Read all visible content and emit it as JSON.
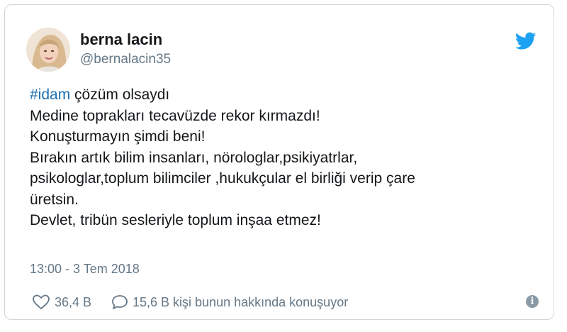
{
  "user": {
    "name": "berna lacin",
    "handle": "@bernalacin35"
  },
  "tweet": {
    "hashtag": "#idam",
    "first_line_rest": " çözüm olsaydı",
    "lines": [
      "Medine toprakları tecavüzde rekor kırmazdı!",
      "Konuşturmayın şimdi beni!",
      "Bırakın artık bilim insanları, nörologlar,psikiyatrlar,",
      "psikologlar,toplum bilimciler ,hukukçular el birliği verip çare",
      "üretsin.",
      "Devlet, tribün sesleriyle toplum inşaa etmez!"
    ]
  },
  "timestamp": "13:00 - 3 Tem 2018",
  "footer": {
    "likes": "36,4 B",
    "replies_text": "15,6 B kişi bunun hakkında konuşuyor",
    "info_icon": "i"
  },
  "colors": {
    "hashtag": "#1b6fb3",
    "twitter_blue": "#1da1f2",
    "secondary_text": "#657786"
  },
  "icons": {
    "brand": "twitter-bird-icon",
    "like": "heart-icon",
    "reply": "speech-bubble-icon",
    "info": "info-icon"
  }
}
